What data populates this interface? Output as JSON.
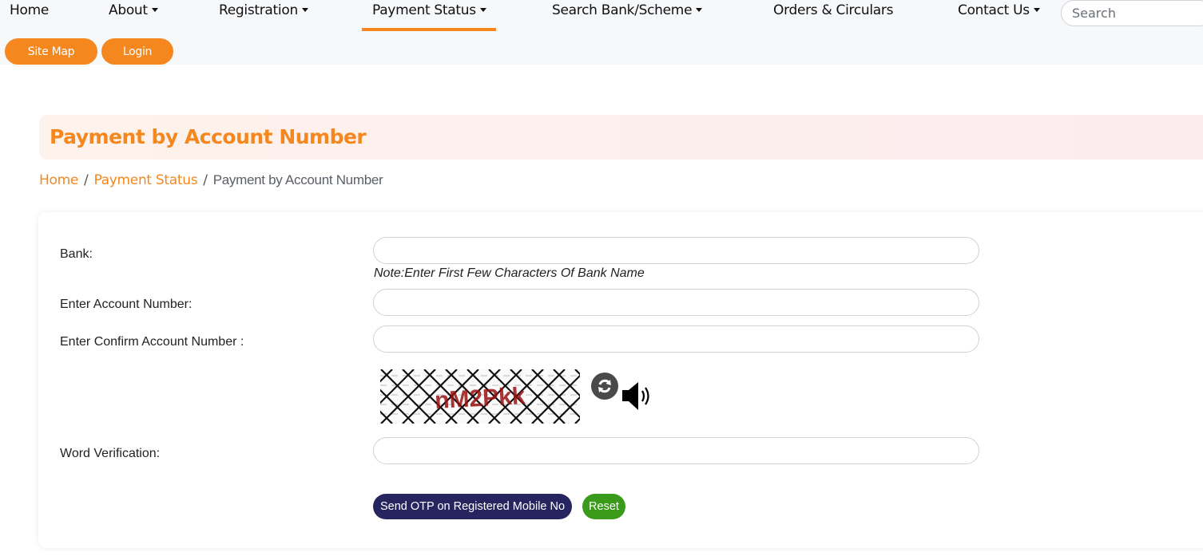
{
  "nav": {
    "items": [
      {
        "label": "Home",
        "has_dropdown": false,
        "active": false
      },
      {
        "label": "About",
        "has_dropdown": true,
        "active": false
      },
      {
        "label": "Registration",
        "has_dropdown": true,
        "active": false
      },
      {
        "label": "Payment Status",
        "has_dropdown": true,
        "active": true
      },
      {
        "label": "Search Bank/Scheme",
        "has_dropdown": true,
        "active": false
      },
      {
        "label": "Orders & Circulars",
        "has_dropdown": false,
        "active": false
      },
      {
        "label": "Contact Us",
        "has_dropdown": true,
        "active": false
      }
    ],
    "search_placeholder": "Search",
    "site_map_label": "Site Map",
    "login_label": "Login"
  },
  "page": {
    "title": "Payment by Account Number"
  },
  "breadcrumb": {
    "home": "Home",
    "parent": "Payment Status",
    "current": "Payment by Account Number",
    "separator": "/"
  },
  "form": {
    "bank_label": "Bank:",
    "bank_value": "",
    "bank_note": "Note:Enter First Few Characters Of Bank Name",
    "account_label": "Enter Account Number:",
    "account_value": "",
    "confirm_account_label": "Enter Confirm Account Number :",
    "confirm_account_value": "",
    "captcha_text": "nM2Pkk",
    "captcha_refresh_icon": "refresh-icon",
    "captcha_audio_icon": "speaker-icon",
    "word_verification_label": "Word Verification:",
    "word_verification_value": "",
    "send_otp_label": "Send OTP on Registered Mobile No",
    "reset_label": "Reset"
  },
  "colors": {
    "accent": "#f5871f",
    "otp_button": "#272560",
    "reset_button": "#3a9a1a"
  }
}
